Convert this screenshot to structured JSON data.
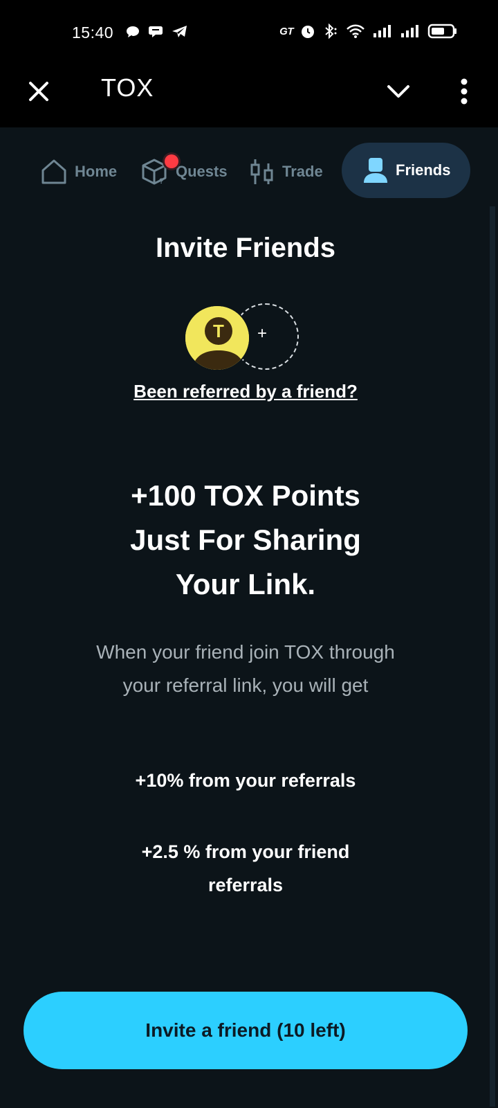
{
  "status_bar": {
    "time": "15:40",
    "gt_label": "GT",
    "icons": [
      "chat-bubble-icon",
      "message-icon",
      "telegram-icon",
      "alarm-icon",
      "bluetooth-icon",
      "wifi-icon",
      "signal-icon",
      "signal-icon",
      "battery-icon"
    ]
  },
  "app_bar": {
    "title": "TOX"
  },
  "tabs": [
    {
      "label": "Home",
      "icon": "home-icon",
      "active": false
    },
    {
      "label": "Quests",
      "icon": "cube-icon",
      "active": false
    },
    {
      "label": "Trade",
      "icon": "candlestick-icon",
      "active": false
    },
    {
      "label": "Friends",
      "icon": "user-icon",
      "active": true
    }
  ],
  "main": {
    "heading": "Invite Friends",
    "avatar_letter": "T",
    "avatar_plus": "+",
    "referred_link": "Been referred by a friend?",
    "promo_lines": [
      "+100 TOX Points",
      "Just For Sharing",
      "Your Link."
    ],
    "description": "When your friend join TOX through your referral link, you will get",
    "reward_1": "+10% from your referrals",
    "reward_2": "+2.5 % from your friend referrals"
  },
  "invite_button": {
    "label": "Invite a friend (10 left)"
  },
  "colors": {
    "background": "#0c1419",
    "accent": "#2ccfff",
    "active_tab_bg": "#1c3246",
    "inactive_tab": "#6f8693",
    "notification_dot": "#ff3b43",
    "avatar_bg": "#f1e65c"
  }
}
